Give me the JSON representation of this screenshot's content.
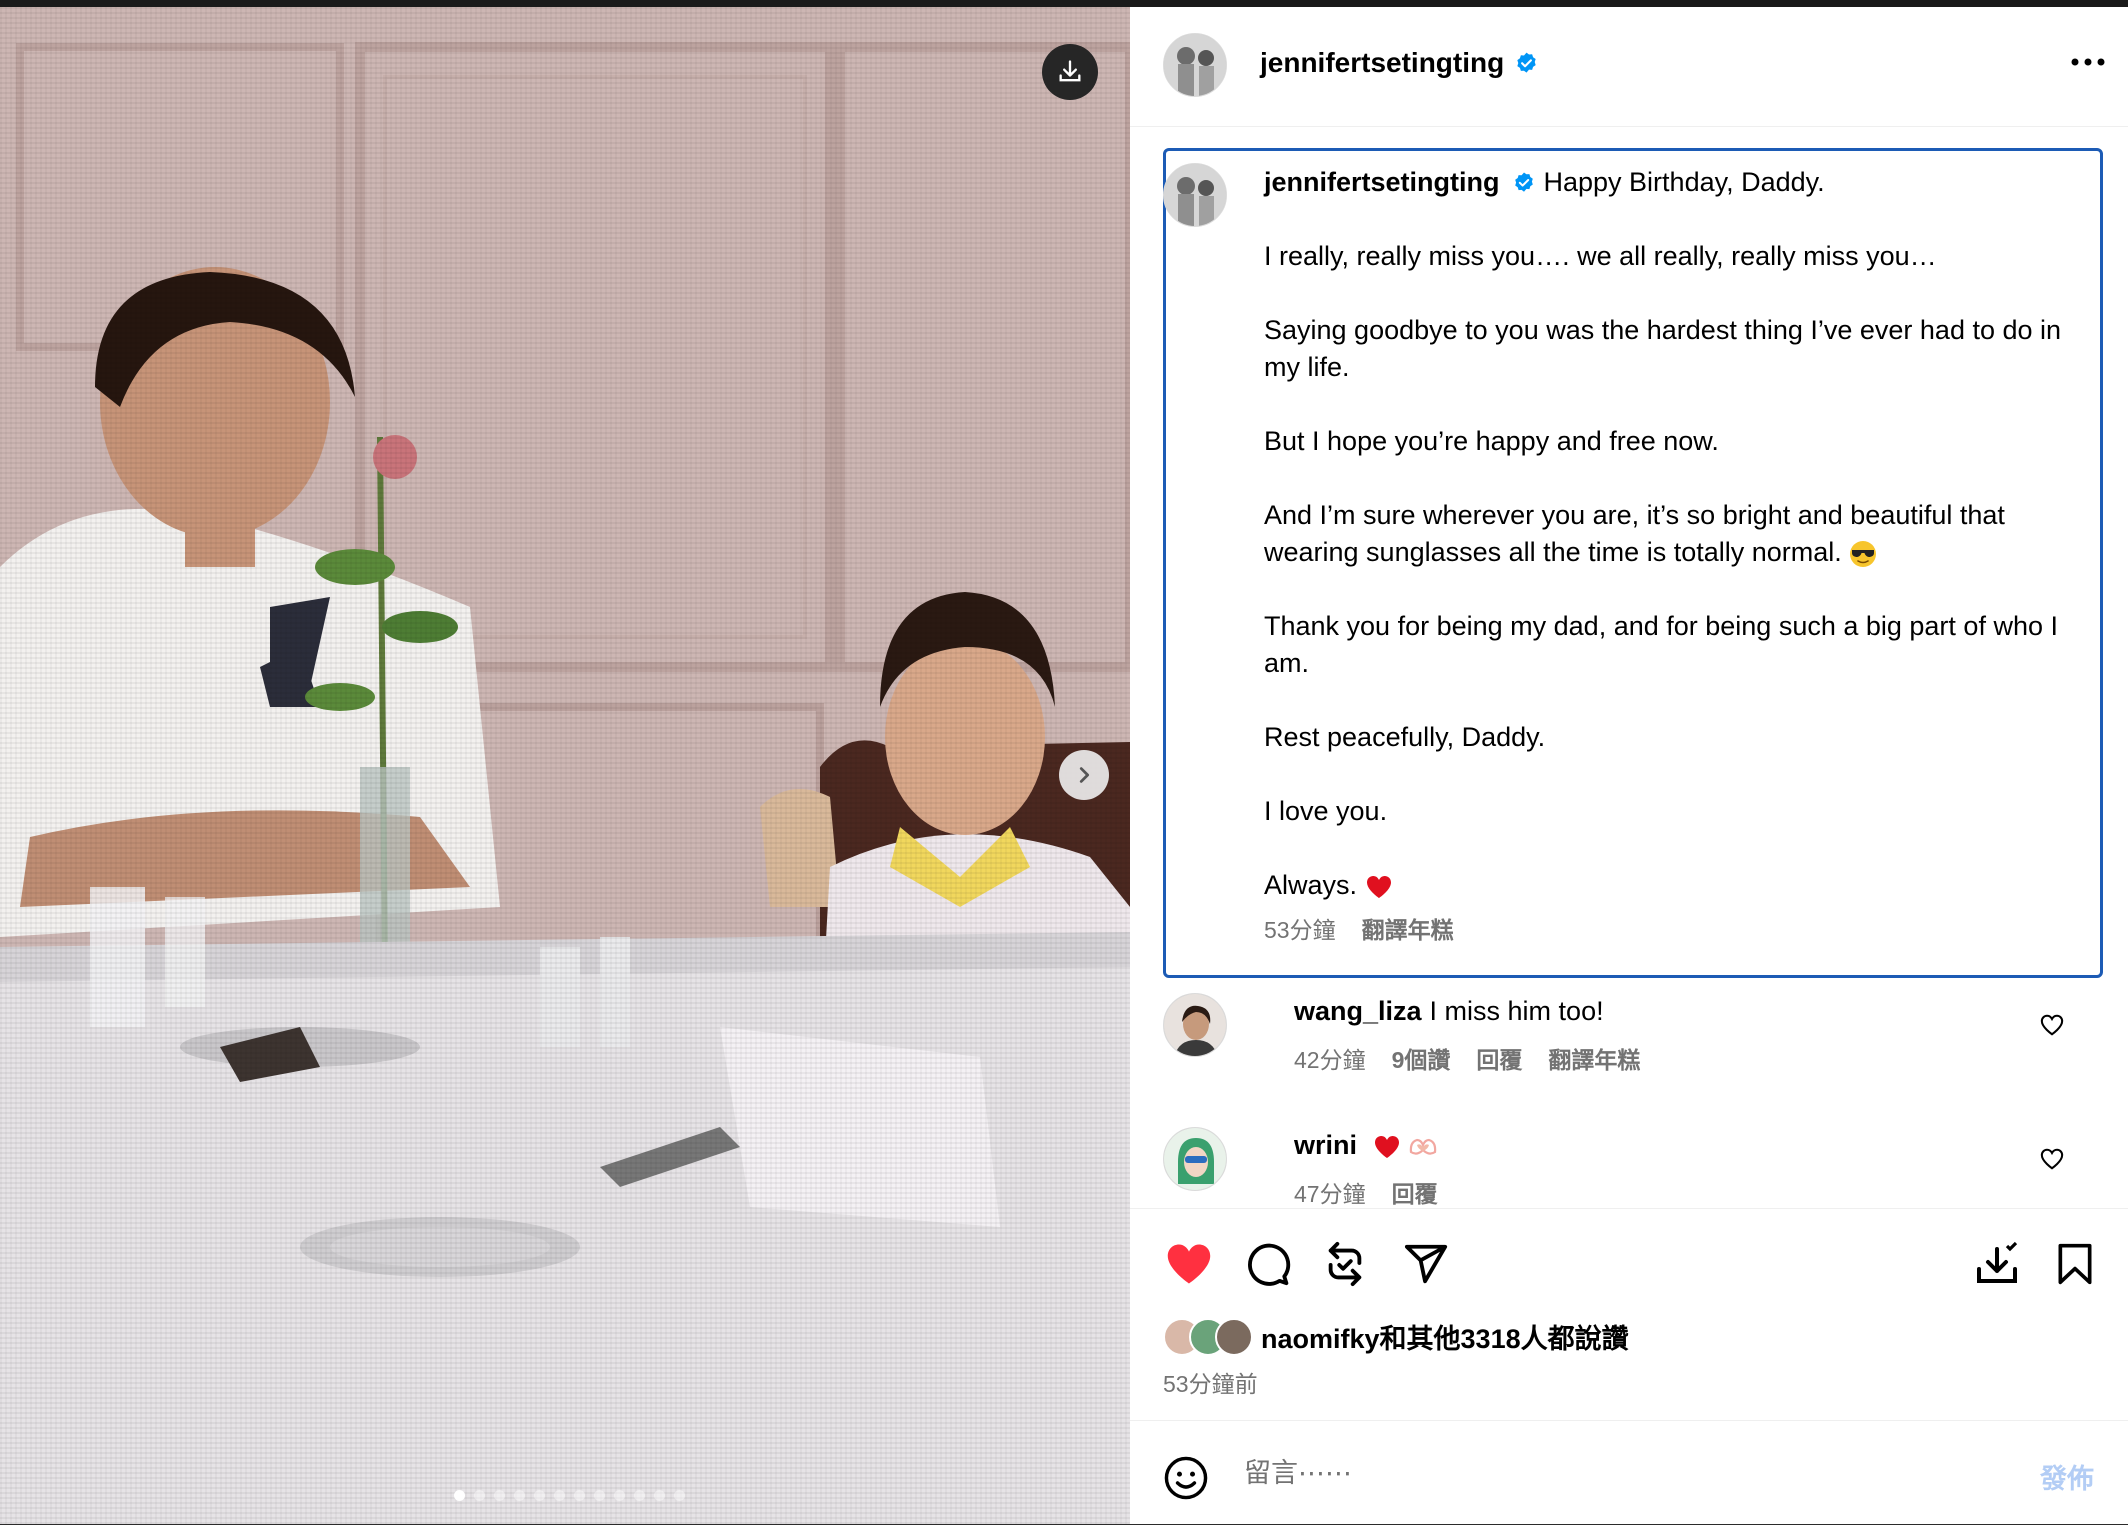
{
  "post": {
    "username": "jennifertsetingting",
    "verified": true
  },
  "caption": {
    "first_line": "Happy Birthday, Daddy.",
    "paragraphs": [
      "I really, really miss you…. we all really, really miss you…",
      "Saying goodbye to you was the hardest thing I’ve ever had to do in my life.",
      "But I hope you’re happy and free now.",
      "And I’m sure wherever you are, it’s so bright and beautiful that wearing sunglasses all the time is totally normal.",
      "Thank you for being my dad, and for being such a big part of who I am.",
      "Rest peacefully, Daddy.",
      "I love you.",
      "Always."
    ],
    "time": "53分鐘",
    "translate": "翻譯年糕"
  },
  "comments": [
    {
      "username": "wang_liza",
      "text": "I miss him too!",
      "time": "42分鐘",
      "likes": "9個讚",
      "reply": "回覆",
      "translate": "翻譯年糕"
    },
    {
      "username": "wrini",
      "text": "",
      "time": "47分鐘",
      "reply": "回覆"
    }
  ],
  "likes_summary": "naomifky和其他3318人都說讚",
  "posted_ago": "53分鐘前",
  "comment_box": {
    "placeholder": "留言⋯⋯",
    "post_label": "發佈"
  },
  "carousel": {
    "slide_count": 12,
    "current": 1
  },
  "icons": {
    "download": "download-icon",
    "next": "chevron-right-icon",
    "verified": "verified-badge-icon",
    "more": "more-icon",
    "heart": "heart-icon",
    "comment": "comment-icon",
    "repost": "repost-icon",
    "share": "share-icon",
    "save": "bookmark-icon",
    "emoji": "emoji-icon"
  },
  "colors": {
    "accent": "#1c5bb5",
    "verified": "#0095f6",
    "like": "#ff3040",
    "post_button": "#b3cdf5",
    "meta": "#737373"
  }
}
